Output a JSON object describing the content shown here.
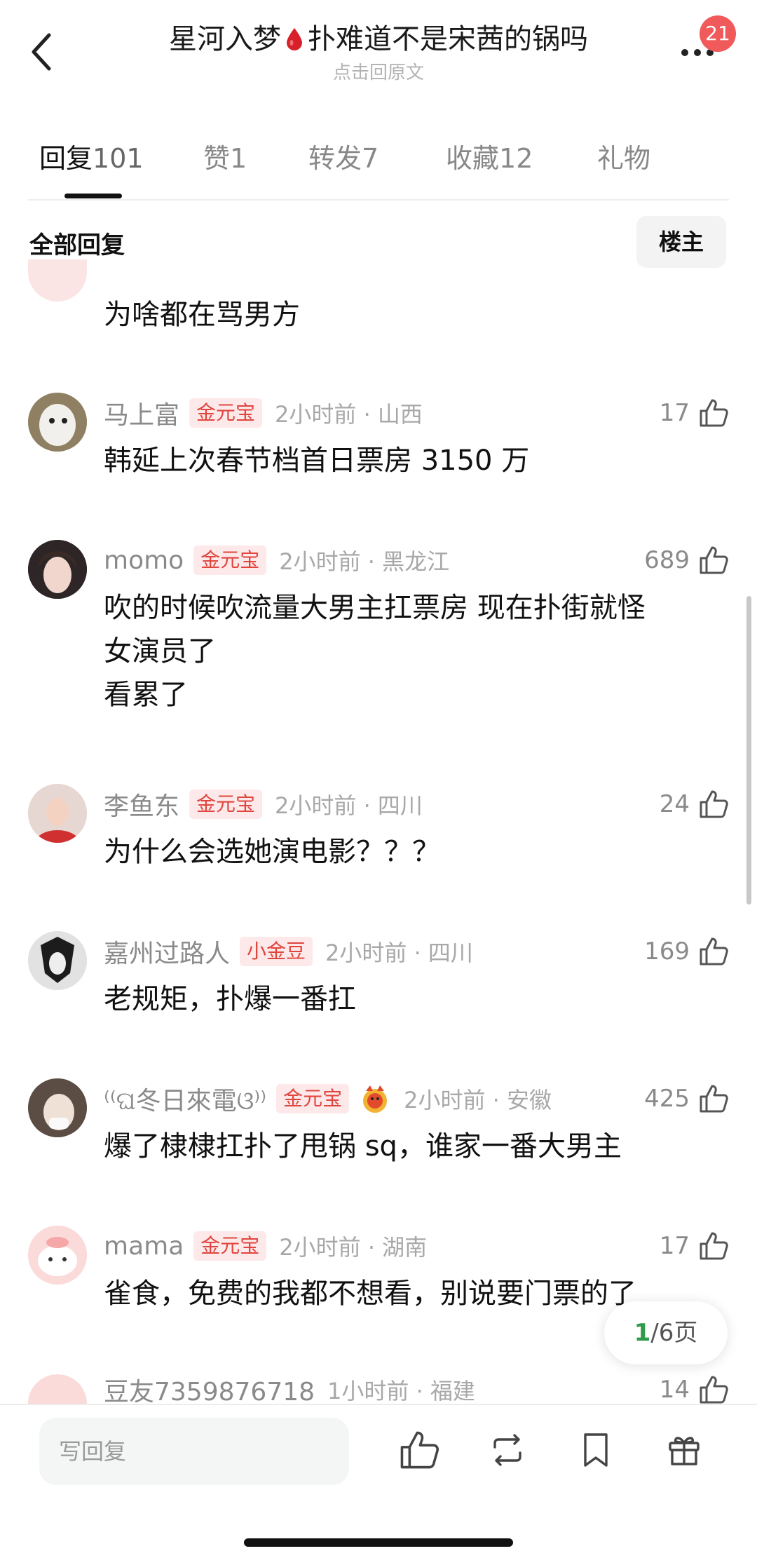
{
  "header": {
    "title_left": "星河入梦",
    "title_right": "扑难道不是宋茜的锅吗",
    "subtitle": "点击回原文",
    "notification_count": "21"
  },
  "tabs": [
    {
      "label": "回复",
      "count": "101"
    },
    {
      "label": "赞",
      "count": "1"
    },
    {
      "label": "转发",
      "count": "7"
    },
    {
      "label": "收藏",
      "count": "12"
    },
    {
      "label": "礼物",
      "count": ""
    }
  ],
  "filter": {
    "label": "全部回复",
    "button": "楼主"
  },
  "comments": [
    {
      "text": "为啥都在骂男方"
    },
    {
      "name": "马上富",
      "tag": "金元宝",
      "time": "2小时前 · 山西",
      "likes": "17",
      "text": "韩延上次春节档首日票房 3150 万"
    },
    {
      "name": "momo",
      "tag": "金元宝",
      "time": "2小时前 · 黑龙江",
      "likes": "689",
      "text": "吹的时候吹流量大男主扛票房 现在扑街就怪\n女演员了\n看累了"
    },
    {
      "name": "李鱼东",
      "tag": "金元宝",
      "time": "2小时前 · 四川",
      "likes": "24",
      "text": "为什么会选她演电影？？？"
    },
    {
      "name": "嘉州过路人",
      "tag": "小金豆",
      "time": "2小时前 · 四川",
      "likes": "169",
      "text": "老规矩，扑爆一番扛"
    },
    {
      "name": "⁽⁽ଘ冬日來電ଓ⁾⁾",
      "tag": "金元宝",
      "time": "2小时前 · 安徽",
      "likes": "425",
      "text": "爆了棣棣扛扑了甩锅 sq，谁家一番大男主"
    },
    {
      "name": "mama",
      "tag": "金元宝",
      "time": "2小时前 · 湖南",
      "likes": "17",
      "text": "雀食，免费的我都不想看，别说要门票的了"
    },
    {
      "name": "豆友7359876718",
      "tag": "",
      "time": "1小时前 · 福建",
      "likes": "14",
      "text": ""
    }
  ],
  "pager": {
    "current": "1",
    "total_text": "/6页"
  },
  "bottom": {
    "reply_placeholder": "写回复"
  },
  "colors": {
    "accent_red": "#e0453e",
    "pager_green": "#2e9a4a",
    "badge_red": "#f05a5a"
  }
}
